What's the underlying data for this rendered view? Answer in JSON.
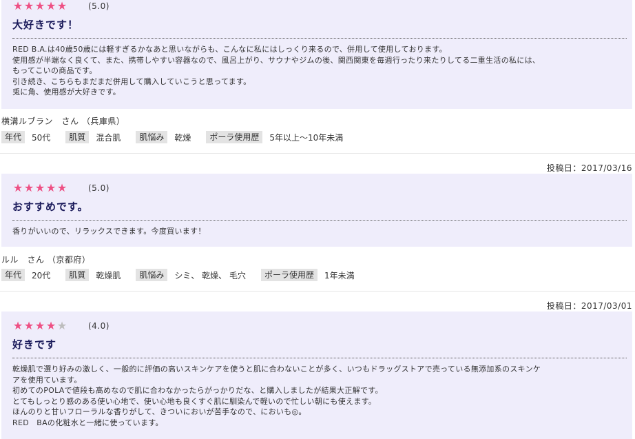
{
  "reviews": [
    {
      "posted": "",
      "stars": 5,
      "score": "(5.0)",
      "title": "大好きです！",
      "body": [
        "RED B.A.は40歳50歳には軽すぎるかなあと思いながらも、こんなに私にはしっくり来るので、併用して使用しております。",
        "使用感が半端なく良くて、また、携帯しやすい容器なので、風呂上がり、サウナやジムの後、関西関東を毎週行ったり来たりしてる二重生活の私には、",
        "もってこいの商品です。",
        "引き続き、こちらもまだまだ併用して購入していこうと思ってます。",
        "兎に角、使用感が大好きです。"
      ],
      "reviewer": "横溝ルブラン　さん （兵庫県）",
      "attrs": [
        {
          "label": "年代",
          "value": "50代"
        },
        {
          "label": "肌質",
          "value": "混合肌"
        },
        {
          "label": "肌悩み",
          "value": "乾燥"
        },
        {
          "label": "ポーラ使用歴",
          "value": "5年以上〜10年未満"
        }
      ]
    },
    {
      "posted": "投稿日：2017/03/16",
      "stars": 5,
      "score": "(5.0)",
      "title": "おすすめです。",
      "body": [
        "香りがいいので、リラックスできます。今度買います！"
      ],
      "reviewer": "ルル　さん （京都府）",
      "attrs": [
        {
          "label": "年代",
          "value": "20代"
        },
        {
          "label": "肌質",
          "value": "乾燥肌"
        },
        {
          "label": "肌悩み",
          "value": "シミ、 乾燥、 毛穴"
        },
        {
          "label": "ポーラ使用歴",
          "value": "1年未満"
        }
      ]
    },
    {
      "posted": "投稿日：2017/03/01",
      "stars": 4,
      "score": "(4.0)",
      "title": "好きです",
      "body": [
        "乾燥肌で選り好みの激しく、一般的に評価の高いスキンケアを使うと肌に合わないことが多く、いつもドラッグストアで売っている無添加系のスキンケ",
        "アを使用ています。",
        "初めてのPOLAで値段も高めなので肌に合わなかったらがっかりだな、と購入しましたが結果大正解です。",
        "とてもしっとり感のある使い心地で、使い心地も良くすぐ肌に馴染んで軽いので忙しい朝にも使えます。",
        "ほんのりと甘いフローラルな香りがして、きついにおいが苦手なので、においも◎。",
        "RED　BAの化粧水と一緒に使っています。"
      ],
      "reviewer": "",
      "attrs": []
    }
  ],
  "colors": {
    "star_on": "#ee4f83",
    "star_off": "#bdbdbd",
    "panel": "#efedfb",
    "title": "#1a1a5a"
  },
  "icons": {
    "star": "star-icon"
  }
}
